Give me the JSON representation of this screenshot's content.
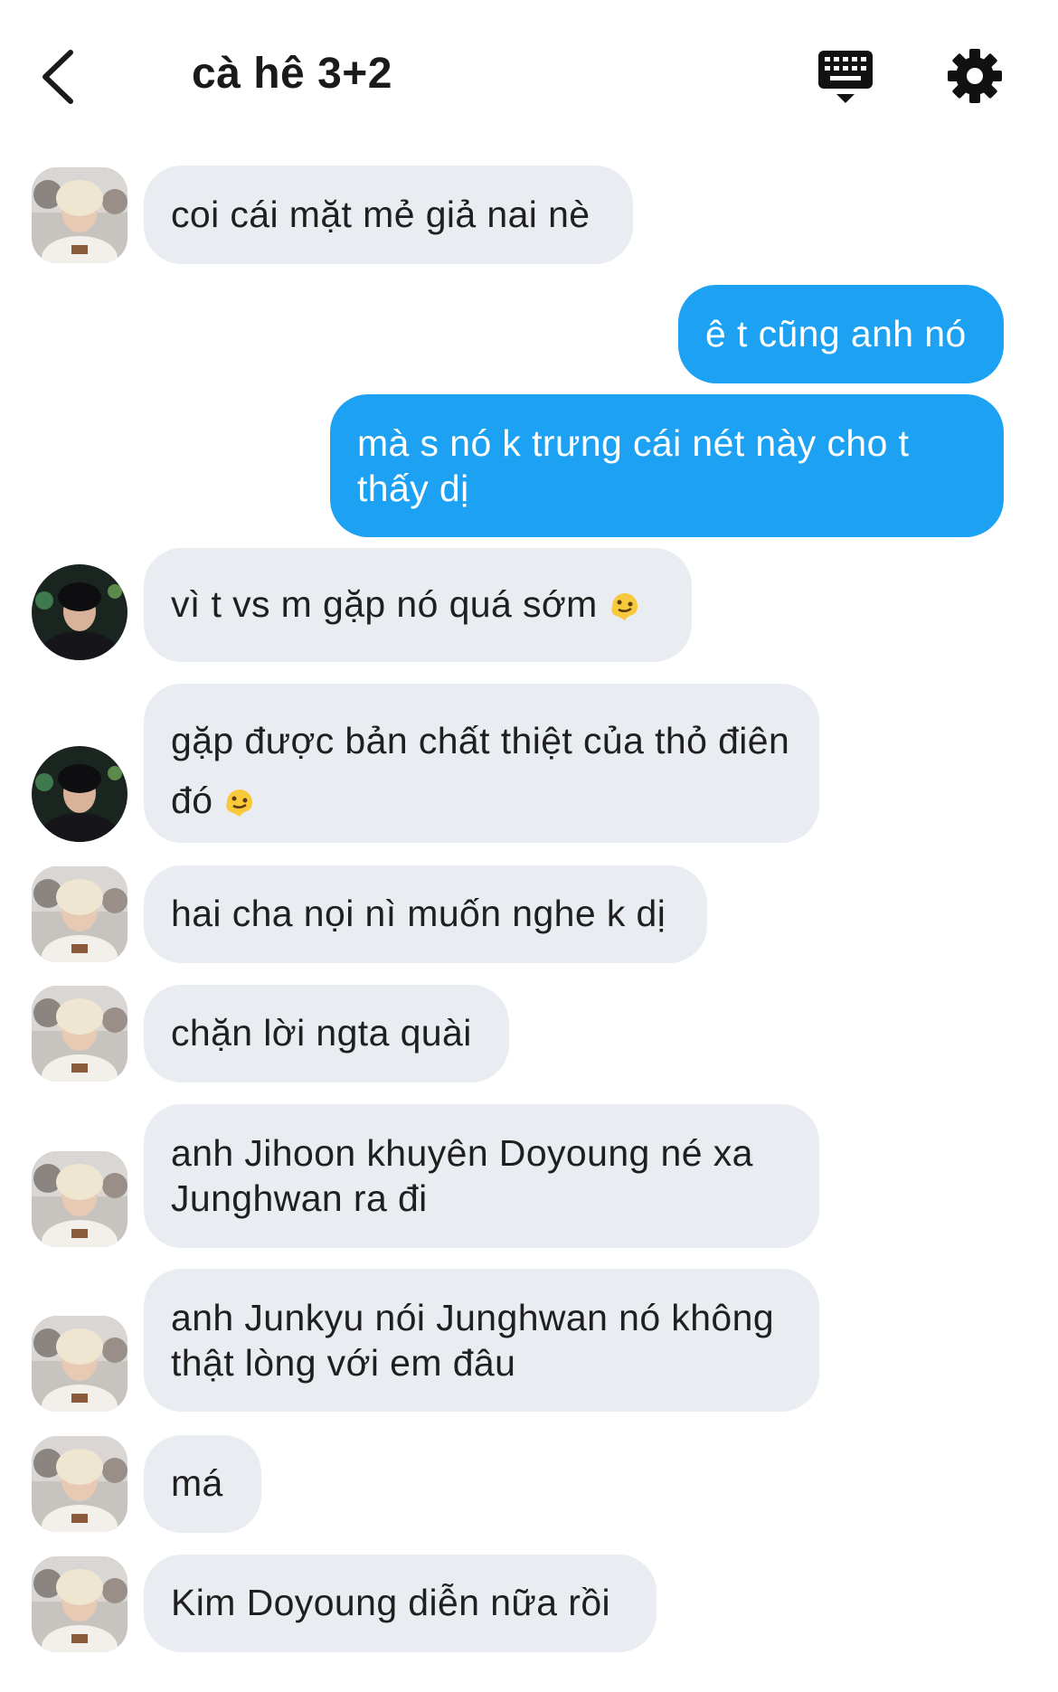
{
  "header": {
    "title": "cà hê 3+2"
  },
  "messages": [
    {
      "text": "coi cái mặt mẻ giả nai nè"
    },
    {
      "text": "ê t cũng anh nó"
    },
    {
      "text": "mà s nó k trưng cái nét này cho t thấy dị"
    },
    {
      "text": "vì t vs m gặp nó quá sớm"
    },
    {
      "text": "gặp được bản chất thiệt của thỏ điên đó"
    },
    {
      "text": "hai cha nọi nì muốn nghe k dị"
    },
    {
      "text": "chặn lời ngta quài"
    },
    {
      "text": "anh Jihoon khuyên Doyoung né xa Junghwan ra đi"
    },
    {
      "text": "anh Junkyu nói Junghwan nó không thật lòng với em đâu"
    },
    {
      "text": "má"
    },
    {
      "text": "Kim Doyoung diễn nữa rồi"
    }
  ],
  "colors": {
    "incoming_bubble": "#e9ecf0",
    "outgoing_bubble": "#1da1f2",
    "text": "#1f1f1f"
  },
  "icons": {
    "back": "chevron-left-icon",
    "keyboard": "keyboard-icon",
    "settings": "gear-icon",
    "emoji": "melting-face-emoji"
  }
}
